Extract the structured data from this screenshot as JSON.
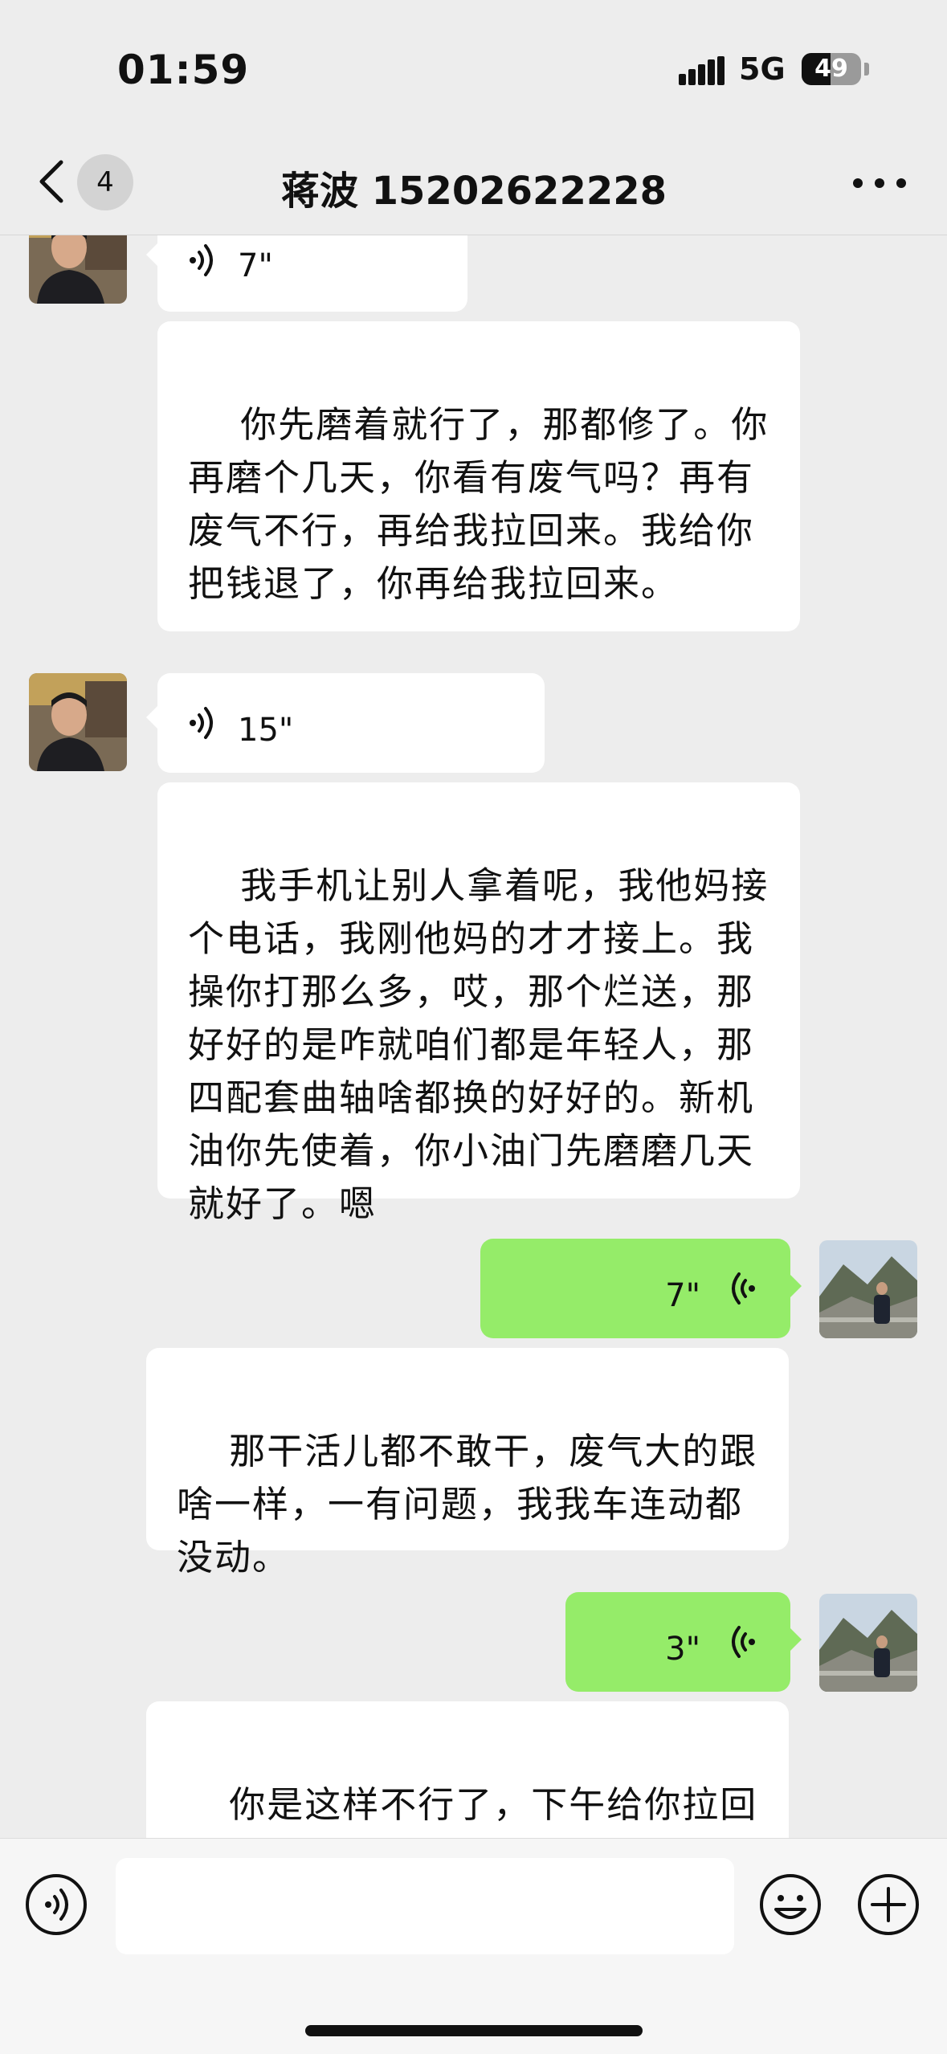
{
  "status": {
    "time": "01:59",
    "network": "5G",
    "battery": "49",
    "battery_level": 0.49
  },
  "nav": {
    "unread_count": "4",
    "title": "蒋波 15202622228"
  },
  "messages": [
    {
      "from": "them",
      "type": "voice",
      "duration": "7\""
    },
    {
      "from": "them",
      "type": "transcript",
      "text": "你先磨着就行了，那都修了。你再磨个几天，你看有废气吗？再有废气不行，再给我拉回来。我给你把钱退了，你再给我拉回来。"
    },
    {
      "from": "them",
      "type": "voice",
      "duration": "15\""
    },
    {
      "from": "them",
      "type": "transcript",
      "text": "我手机让别人拿着呢，我他妈接个电话，我刚他妈的才才接上。我操你打那么多，哎，那个烂送，那好好的是咋就咱们都是年轻人，那四配套曲轴啥都换的好好的。新机油你先使着，你小油门先磨磨几天就好了。嗯"
    },
    {
      "from": "me",
      "type": "voice",
      "duration": "7\""
    },
    {
      "from": "me",
      "type": "transcript",
      "text": "那干活儿都不敢干，废气大的跟啥一样，一有问题，我我车连动都没动。"
    },
    {
      "from": "me",
      "type": "voice",
      "duration": "3\""
    },
    {
      "from": "me",
      "type": "transcript",
      "text": "你是这样不行了，下午给你拉回去吧。"
    }
  ],
  "icons": {
    "back": "chevron-left-icon",
    "more": "more-dots-icon",
    "voice_toggle": "voice-wave-icon",
    "emoji": "smiley-icon",
    "plus": "plus-circle-icon"
  },
  "colors": {
    "bg": "#ededed",
    "my_bubble": "#95ec69",
    "their_bubble": "#ffffff"
  }
}
